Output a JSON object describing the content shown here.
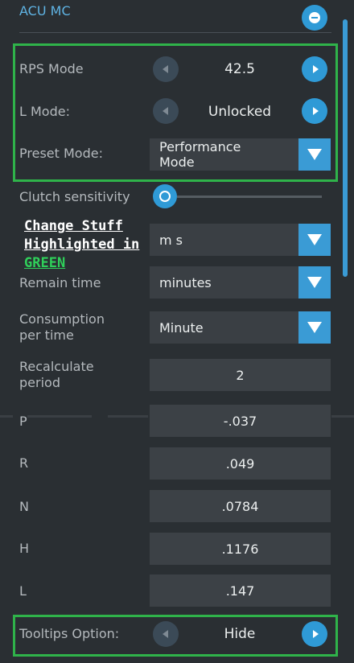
{
  "header": {
    "title": "ACU MC"
  },
  "rps_mode": {
    "label": "RPS Mode",
    "value": "42.5"
  },
  "l_mode": {
    "label": "L Mode:",
    "value": "Unlocked"
  },
  "preset_mode": {
    "label": "Preset Mode:",
    "value_line1": "Performance",
    "value_line2": "Mode"
  },
  "clutch": {
    "label": "Clutch sensitivity",
    "value_fraction": 0.0
  },
  "overlay": {
    "line1": "Change Stuff",
    "line2": "Highlighted in",
    "line3": "GREEN"
  },
  "row_unit": {
    "value": "m s"
  },
  "remain_time": {
    "label": "Remain time",
    "value": "minutes"
  },
  "consumption": {
    "label_line1": "Consumption",
    "label_line2": "per time",
    "value": "Minute"
  },
  "recalc": {
    "label_line1": "Recalculate",
    "label_line2": "period",
    "value": "2"
  },
  "params": [
    {
      "label": "P",
      "value": "-.037"
    },
    {
      "label": "R",
      "value": ".049"
    },
    {
      "label": "N",
      "value": ".0784"
    },
    {
      "label": "H",
      "value": ".1176"
    },
    {
      "label": "L",
      "value": ".147"
    }
  ],
  "tooltips": {
    "label": "Tooltips Option:",
    "value": "Hide"
  },
  "colors": {
    "accent": "#2f9ad6",
    "highlight": "#2fb34a",
    "background": "#2a2f33"
  }
}
